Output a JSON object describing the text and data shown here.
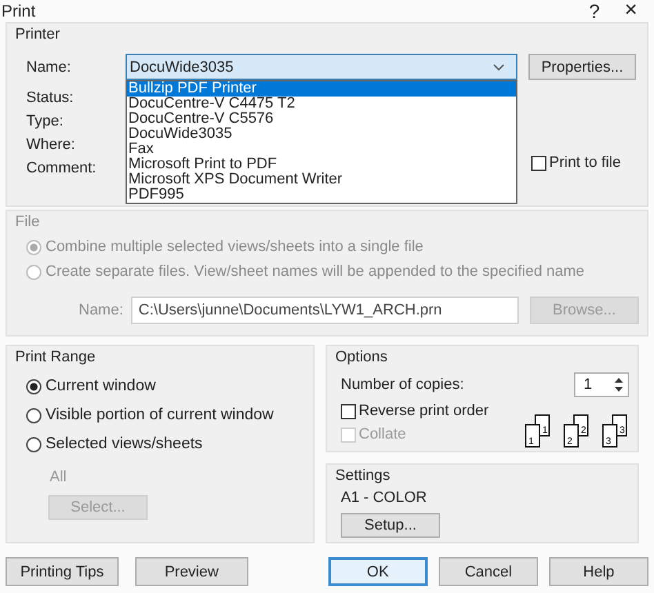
{
  "window": {
    "title": "Print",
    "help": "?",
    "close": "×"
  },
  "printer": {
    "title": "Printer",
    "name_label": "Name:",
    "name_value": "DocuWide3035",
    "properties_button": "Properties...",
    "dropdown": {
      "expanded": true,
      "options": [
        {
          "label": "Bullzip PDF Printer",
          "selected": true
        },
        {
          "label": "DocuCentre-V C4475 T2",
          "selected": false
        },
        {
          "label": "DocuCentre-V C5576",
          "selected": false
        },
        {
          "label": "DocuWide3035",
          "selected": false
        },
        {
          "label": "Fax",
          "selected": false
        },
        {
          "label": "Microsoft Print to PDF",
          "selected": false
        },
        {
          "label": "Microsoft XPS Document Writer",
          "selected": false
        },
        {
          "label": "PDF995",
          "selected": false
        }
      ]
    },
    "info_labels": [
      "Status:",
      "Type:",
      "Where:",
      "Comment:"
    ],
    "print_to_file": {
      "label": "Print to file",
      "checked": false
    }
  },
  "file": {
    "title": "File",
    "disabled": true,
    "options": [
      {
        "label": "Combine multiple selected views/sheets into a single file",
        "selected": true
      },
      {
        "label": "Create separate files. View/sheet names will be appended to the specified name",
        "selected": false
      }
    ],
    "name_label": "Name:",
    "name_value": "C:\\Users\\junne\\Documents\\LYW1_ARCH.prn",
    "browse_button": "Browse..."
  },
  "print_range": {
    "title": "Print Range",
    "options": [
      {
        "label": "Current window",
        "selected": true
      },
      {
        "label": "Visible portion of current window",
        "selected": false
      },
      {
        "label": "Selected views/sheets",
        "selected": false
      }
    ],
    "sheets_label": "All",
    "select_button": "Select...",
    "select_disabled": true
  },
  "options": {
    "title": "Options",
    "copies_label": "Number of copies:",
    "copies": "1",
    "checks": [
      {
        "label": "Reverse print order",
        "checked": false,
        "disabled": false
      },
      {
        "label": "Collate",
        "checked": false,
        "disabled": true
      }
    ],
    "pages": [
      {
        "front": "1",
        "back": "1"
      },
      {
        "front": "2",
        "back": "2"
      },
      {
        "front": "3",
        "back": "3"
      }
    ]
  },
  "settings": {
    "title": "Settings",
    "value": "A1 - COLOR",
    "setup_button": "Setup..."
  },
  "buttons": [
    {
      "label": "Printing Tips",
      "default": false
    },
    {
      "label": "Preview",
      "default": false
    },
    {
      "label": "OK",
      "default": true
    },
    {
      "label": "Cancel",
      "default": false
    },
    {
      "label": "Help",
      "default": false
    }
  ]
}
